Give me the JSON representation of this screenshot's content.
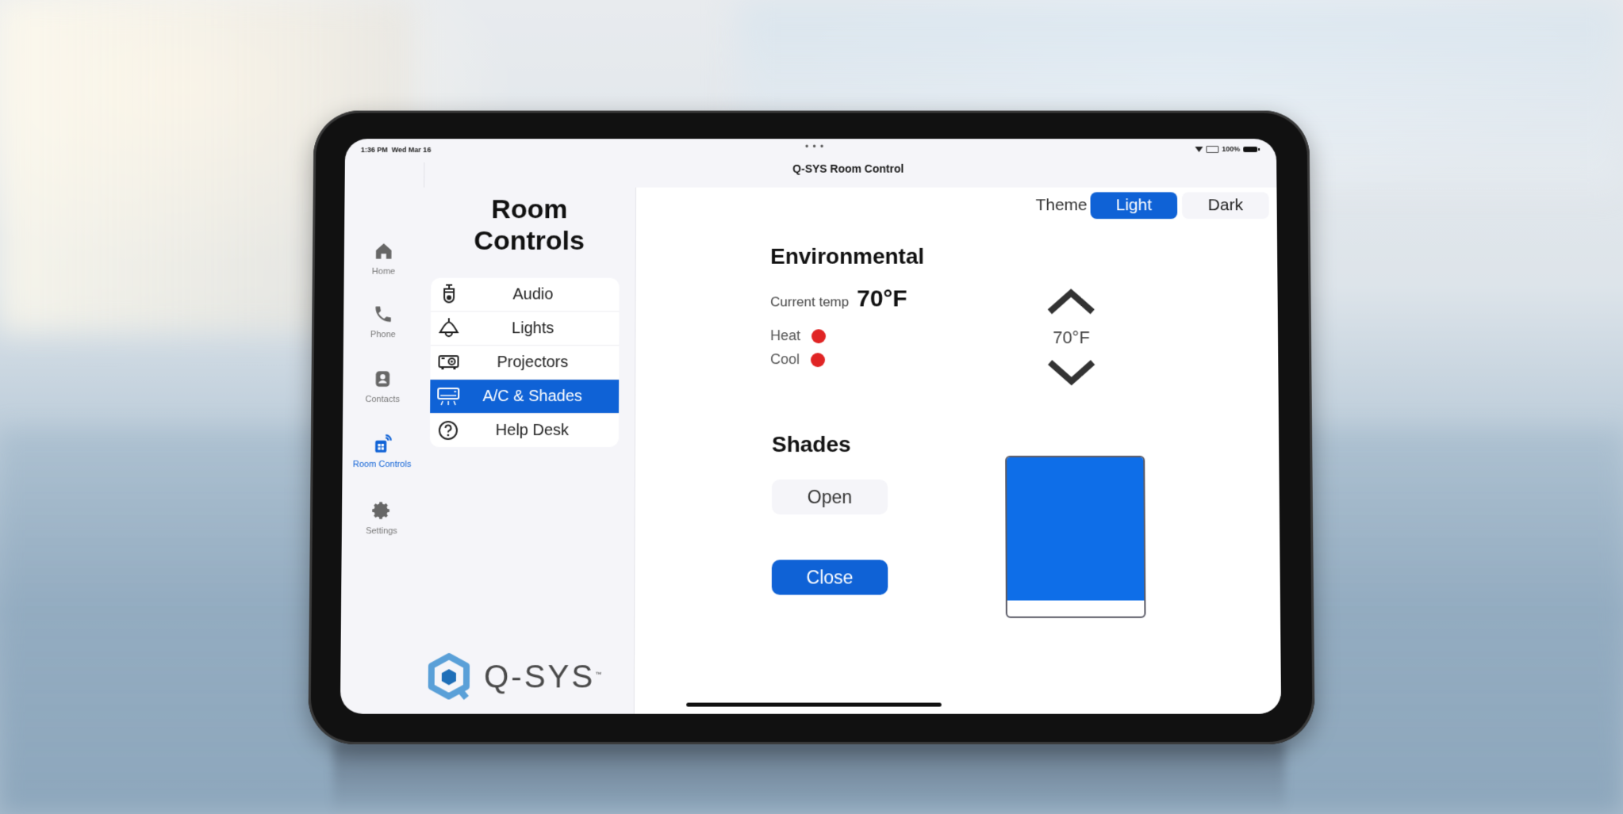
{
  "status_bar": {
    "time": "1:36 PM",
    "date": "Wed Mar 16",
    "battery": "100%",
    "dots": "• • •"
  },
  "app": {
    "title": "Q-SYS Room Control"
  },
  "rail": {
    "items": [
      {
        "label": "Home",
        "icon": "home-icon",
        "active": false
      },
      {
        "label": "Phone",
        "icon": "phone-icon",
        "active": false
      },
      {
        "label": "Contacts",
        "icon": "contacts-icon",
        "active": false
      },
      {
        "label": "Room Controls",
        "icon": "room-controls-icon",
        "active": true
      },
      {
        "label": "Settings",
        "icon": "gear-icon",
        "active": false
      }
    ]
  },
  "subnav": {
    "title_line1": "Room",
    "title_line2": "Controls",
    "items": [
      {
        "label": "Audio",
        "icon": "speaker-icon",
        "active": false
      },
      {
        "label": "Lights",
        "icon": "pendant-lamp-icon",
        "active": false
      },
      {
        "label": "Projectors",
        "icon": "projector-icon",
        "active": false
      },
      {
        "label": "A/C & Shades",
        "icon": "air-conditioner-icon",
        "active": true
      },
      {
        "label": "Help Desk",
        "icon": "help-circle-icon",
        "active": false
      }
    ],
    "logo_text": "Q-SYS",
    "logo_tm": "™"
  },
  "theme": {
    "label": "Theme",
    "options": [
      "Light",
      "Dark"
    ],
    "selected": "Light"
  },
  "environmental": {
    "heading": "Environmental",
    "current_temp_label": "Current temp",
    "current_temp": "70°F",
    "heat_label": "Heat",
    "cool_label": "Cool",
    "heat_status_color": "#e02424",
    "cool_status_color": "#e02424",
    "setpoint": "70°F"
  },
  "shades": {
    "heading": "Shades",
    "open_label": "Open",
    "close_label": "Close",
    "closed_fraction": 0.9
  },
  "colors": {
    "accent": "#0f62d6",
    "shade_fill": "#0e6ee8",
    "status_red": "#e02424"
  }
}
